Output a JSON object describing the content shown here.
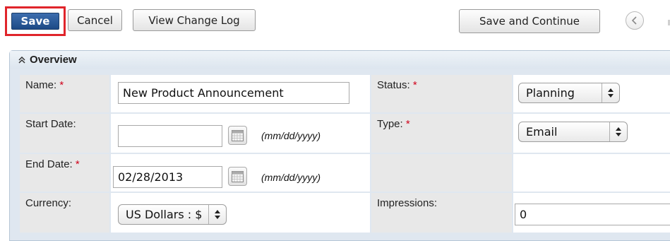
{
  "toolbar": {
    "save_label": "Save",
    "cancel_label": "Cancel",
    "change_log_label": "View Change Log",
    "save_continue_label": "Save and Continue"
  },
  "panel": {
    "title": "Overview"
  },
  "fields": {
    "name": {
      "label": "Name:",
      "required": "*",
      "value": "New Product Announcement"
    },
    "status": {
      "label": "Status:",
      "required": "*",
      "value": "Planning"
    },
    "start_date": {
      "label": "Start Date:",
      "value": "",
      "hint": "(mm/dd/yyyy)"
    },
    "type": {
      "label": "Type:",
      "required": "*",
      "value": "Email"
    },
    "end_date": {
      "label": "End Date:",
      "required": "*",
      "value": "02/28/2013",
      "hint": "(mm/dd/yyyy)"
    },
    "currency": {
      "label": "Currency:",
      "value": "US Dollars : $"
    },
    "impressions": {
      "label": "Impressions:",
      "value": "0"
    }
  },
  "icons": {
    "nav_prev": "chevron-left-icon",
    "collapse": "double-chevron-up-icon",
    "calendar": "calendar-icon",
    "select_arrows": "up-down-arrows-icon"
  },
  "colors": {
    "save_button": "#2a5a99",
    "highlight_border": "#e0252b",
    "required_marker": "#d0021b",
    "panel_header": "#e6edf4",
    "label_cell": "#e8e8e8"
  }
}
